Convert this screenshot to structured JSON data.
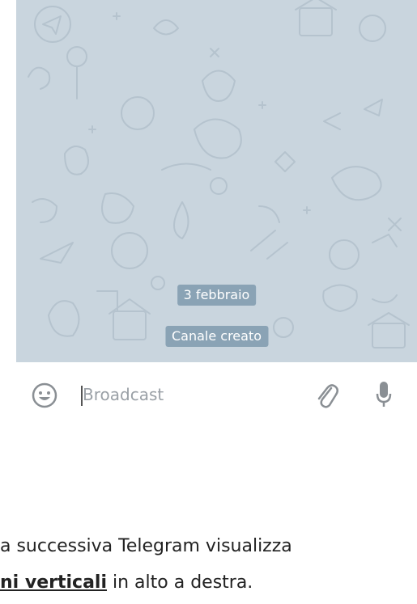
{
  "chat": {
    "date_label": "3 febbraio",
    "service_message": "Canale creato",
    "background_color": "#c9d5de",
    "service_bubble_color": "#8aa3b5"
  },
  "input_bar": {
    "placeholder": "Broadcast",
    "value": "",
    "icons": [
      "smiley-icon",
      "paperclip-icon",
      "microphone-icon"
    ]
  },
  "article": {
    "line1": "a successiva Telegram visualizza",
    "line2_bold": "ni verticali",
    "line2_rest": " in alto a destra."
  }
}
